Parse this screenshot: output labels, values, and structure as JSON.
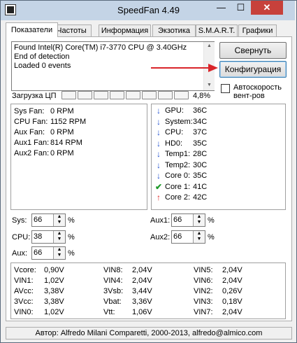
{
  "window": {
    "title": "SpeedFan 4.49",
    "minimize": "—",
    "maximize": "☐",
    "close": "✕"
  },
  "tabs": [
    "Показатели",
    "Частоты",
    "Информация",
    "Экзотика",
    "S.M.A.R.T.",
    "Графики"
  ],
  "active_tab": "Показатели",
  "log": [
    "Found Intel(R) Core(TM) i7-3770 CPU @ 3.40GHz",
    "End of detection",
    "Loaded 0 events"
  ],
  "buttons": {
    "minimize_label": "Свернуть",
    "config_label": "Конфигурация"
  },
  "auto_speed": {
    "label": "Автоскорость вент-ров",
    "checked": false
  },
  "cpu_usage": {
    "label": "Загрузка ЦП",
    "percent_text": "4,8%",
    "segments": 8,
    "value": 4.8
  },
  "fans": [
    {
      "label": "Sys Fan:",
      "value": "0 RPM"
    },
    {
      "label": "CPU Fan:",
      "value": "1152 RPM"
    },
    {
      "label": "Aux Fan:",
      "value": "0 RPM"
    },
    {
      "label": "Aux1 Fan:",
      "value": "814 RPM"
    },
    {
      "label": "Aux2 Fan:",
      "value": "0 RPM"
    }
  ],
  "temps": [
    {
      "label": "GPU:",
      "value": "36C",
      "icon": "arrow-down-icon",
      "glyph": "↓",
      "color": "#1f4fd1"
    },
    {
      "label": "System:",
      "value": "34C",
      "icon": "arrow-down-icon",
      "glyph": "↓",
      "color": "#1f4fd1"
    },
    {
      "label": "CPU:",
      "value": "37C",
      "icon": "arrow-down-icon",
      "glyph": "↓",
      "color": "#1f4fd1"
    },
    {
      "label": "HD0:",
      "value": "35C",
      "icon": "arrow-down-icon",
      "glyph": "↓",
      "color": "#1f4fd1"
    },
    {
      "label": "Temp1:",
      "value": "28C",
      "icon": "arrow-down-icon",
      "glyph": "↓",
      "color": "#1f4fd1"
    },
    {
      "label": "Temp2:",
      "value": "30C",
      "icon": "arrow-down-icon",
      "glyph": "↓",
      "color": "#1f4fd1"
    },
    {
      "label": "Core 0:",
      "value": "35C",
      "icon": "arrow-down-icon",
      "glyph": "↓",
      "color": "#1f4fd1"
    },
    {
      "label": "Core 1:",
      "value": "41C",
      "icon": "check-icon",
      "glyph": "✔",
      "color": "#1f9a2a"
    },
    {
      "label": "Core 2:",
      "value": "42C",
      "icon": "arrow-up-icon",
      "glyph": "↑",
      "color": "#e02020"
    }
  ],
  "speeds": {
    "sys": {
      "label": "Sys:",
      "value": "66",
      "unit": "%"
    },
    "cpu": {
      "label": "CPU:",
      "value": "38",
      "unit": "%"
    },
    "aux": {
      "label": "Aux:",
      "value": "66",
      "unit": "%"
    },
    "aux1": {
      "label": "Aux1:",
      "value": "66",
      "unit": "%"
    },
    "aux2": {
      "label": "Aux2:",
      "value": "66",
      "unit": "%"
    }
  },
  "voltages": [
    [
      {
        "label": "Vcore:",
        "value": "0,90V"
      },
      {
        "label": "VIN1:",
        "value": "1,02V"
      },
      {
        "label": "AVcc:",
        "value": "3,38V"
      },
      {
        "label": "3Vcc:",
        "value": "3,38V"
      },
      {
        "label": "VIN0:",
        "value": "1,02V"
      }
    ],
    [
      {
        "label": "VIN8:",
        "value": "2,04V"
      },
      {
        "label": "VIN4:",
        "value": "2,04V"
      },
      {
        "label": "3Vsb:",
        "value": "3,44V"
      },
      {
        "label": "Vbat:",
        "value": "3,36V"
      },
      {
        "label": "Vtt:",
        "value": "1,06V"
      }
    ],
    [
      {
        "label": "VIN5:",
        "value": "2,04V"
      },
      {
        "label": "VIN6:",
        "value": "2,04V"
      },
      {
        "label": "VIN2:",
        "value": "0,26V"
      },
      {
        "label": "VIN3:",
        "value": "0,18V"
      },
      {
        "label": "VIN7:",
        "value": "2,04V"
      }
    ]
  ],
  "status_bar": "Автор: Alfredo Milani Comparetti, 2000-2013, alfredo@almico.com",
  "annotation_arrow_color": "#d9252a"
}
